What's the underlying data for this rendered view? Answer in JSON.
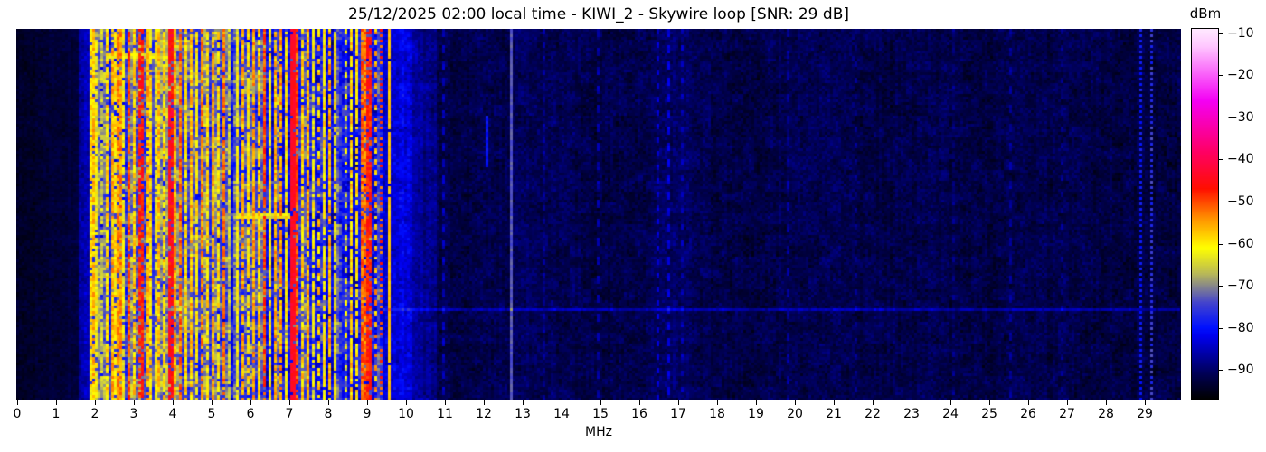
{
  "chart_data": {
    "type": "heatmap",
    "title": "25/12/2025 02:00 local time - KIWI_2 - Skywire loop [SNR: 29 dB]",
    "xlabel": "MHz",
    "x_range": [
      0,
      29.92
    ],
    "x_ticks": [
      0,
      1,
      2,
      3,
      4,
      5,
      6,
      7,
      8,
      9,
      10,
      11,
      12,
      13,
      14,
      15,
      16,
      17,
      18,
      19,
      20,
      21,
      22,
      23,
      24,
      25,
      26,
      27,
      28,
      29
    ],
    "colorbar": {
      "label": "dBm",
      "value_range": [
        -97,
        -9
      ],
      "ticks": [
        {
          "v": -10,
          "label": "−10"
        },
        {
          "v": -20,
          "label": "−20"
        },
        {
          "v": -30,
          "label": "−30"
        },
        {
          "v": -40,
          "label": "−40"
        },
        {
          "v": -50,
          "label": "−50"
        },
        {
          "v": -60,
          "label": "−60"
        },
        {
          "v": -70,
          "label": "−70"
        },
        {
          "v": -80,
          "label": "−80"
        },
        {
          "v": -90,
          "label": "−90"
        }
      ]
    },
    "colormap_stops": [
      [
        -97,
        "#000000"
      ],
      [
        -91,
        "#000055"
      ],
      [
        -82,
        "#0000ee"
      ],
      [
        -80,
        "#0011ff"
      ],
      [
        -74,
        "#4444cc"
      ],
      [
        -67,
        "#bbbb55"
      ],
      [
        -61,
        "#ffff00"
      ],
      [
        -54,
        "#ff9100"
      ],
      [
        -47,
        "#ff0f00"
      ],
      [
        -38,
        "#ff0066"
      ],
      [
        -26,
        "#f400f4"
      ],
      [
        -13,
        "#ffc8ff"
      ],
      [
        -9,
        "#ffe9ff"
      ]
    ],
    "bands": [
      {
        "f0": 0.0,
        "f1": 1.55,
        "base": -94.5,
        "v": 1.6,
        "cv": 0.5,
        "lf": 0.6
      },
      {
        "f0": 1.55,
        "f1": 1.83,
        "base": -88.0,
        "v": 3.0,
        "cv": 1.5,
        "lf": 1.0
      },
      {
        "f0": 1.83,
        "f1": 9.4,
        "base": -78.0,
        "v": 5.5,
        "cv": 4.5,
        "lf": 4.5
      },
      {
        "f0": 9.4,
        "f1": 10.15,
        "base": -85.5,
        "v": 3.5,
        "cv": 1.2,
        "lf": 1.5
      },
      {
        "f0": 10.15,
        "f1": 10.8,
        "base": -89.5,
        "v": 2.8,
        "cv": 0.8,
        "lf": 1.2
      },
      {
        "f0": 10.8,
        "f1": 29.92,
        "base": -92.3,
        "v": 2.6,
        "cv": 0.7,
        "lf": 1.2
      }
    ],
    "humps": [
      {
        "c": 3.9,
        "s": 1.6,
        "a": 6.0
      },
      {
        "c": 10.0,
        "s": 0.5,
        "a": 3.0
      },
      {
        "c": 13.3,
        "s": 0.9,
        "a": 1.5
      },
      {
        "c": 16.9,
        "s": 0.6,
        "a": 2.2
      },
      {
        "c": 20.6,
        "s": 0.9,
        "a": 1.0
      },
      {
        "c": 23.4,
        "s": 0.8,
        "a": 0.8
      },
      {
        "c": 26.6,
        "s": 0.8,
        "a": 0.8
      }
    ],
    "carriers": [
      {
        "f": 1.87,
        "level": -60
      },
      {
        "f": 1.96,
        "level": -57
      },
      {
        "f": 2.06,
        "level": -62
      },
      {
        "f": 2.18,
        "level": -66
      },
      {
        "f": 2.3,
        "level": -59
      },
      {
        "f": 2.42,
        "level": -56
      },
      {
        "f": 2.55,
        "level": -60
      },
      {
        "f": 2.63,
        "level": -54,
        "w": 0.1
      },
      {
        "f": 2.76,
        "level": -62
      },
      {
        "f": 2.89,
        "level": -51,
        "w": 0.1
      },
      {
        "f": 3.01,
        "level": -58
      },
      {
        "f": 3.13,
        "level": -60
      },
      {
        "f": 3.21,
        "level": -47,
        "w": 0.12
      },
      {
        "f": 3.34,
        "level": -56
      },
      {
        "f": 3.44,
        "level": -59
      },
      {
        "f": 3.56,
        "level": -62
      },
      {
        "f": 3.66,
        "level": -57
      },
      {
        "f": 3.79,
        "level": -59
      },
      {
        "f": 3.89,
        "level": -62
      },
      {
        "f": 3.96,
        "level": -45,
        "w": 0.12
      },
      {
        "f": 4.09,
        "level": -56
      },
      {
        "f": 4.21,
        "level": -52
      },
      {
        "f": 4.34,
        "level": -59
      },
      {
        "f": 4.48,
        "level": -57
      },
      {
        "f": 4.63,
        "level": -60
      },
      {
        "f": 4.76,
        "level": -54,
        "w": 0.1
      },
      {
        "f": 4.91,
        "level": -59
      },
      {
        "f": 5.02,
        "level": -56
      },
      {
        "f": 5.16,
        "level": -60
      },
      {
        "f": 5.31,
        "level": -53
      },
      {
        "f": 5.46,
        "level": -66
      },
      {
        "f": 5.63,
        "level": -62
      },
      {
        "f": 5.81,
        "level": -56,
        "w": 0.1
      },
      {
        "f": 5.96,
        "level": -60
      },
      {
        "f": 6.08,
        "level": -55
      },
      {
        "f": 6.21,
        "level": -58
      },
      {
        "f": 6.36,
        "level": -50,
        "w": 0.1
      },
      {
        "f": 6.51,
        "level": -60
      },
      {
        "f": 6.63,
        "level": -56
      },
      {
        "f": 6.81,
        "level": -55
      },
      {
        "f": 6.93,
        "level": -60
      },
      {
        "f": 7.06,
        "level": -44,
        "w": 0.14,
        "jit": 4,
        "drop": 0.05
      },
      {
        "f": 7.19,
        "level": -50
      },
      {
        "f": 7.33,
        "level": -58
      },
      {
        "f": 7.46,
        "level": -56
      },
      {
        "f": 7.61,
        "level": -62
      },
      {
        "f": 7.76,
        "level": -58,
        "dash": [
          3,
          5
        ]
      },
      {
        "f": 7.91,
        "level": -60
      },
      {
        "f": 8.06,
        "level": -56
      },
      {
        "f": 8.18,
        "level": -61
      },
      {
        "f": 8.46,
        "level": -63,
        "dash": [
          2,
          4
        ]
      },
      {
        "f": 8.61,
        "level": -58
      },
      {
        "f": 8.76,
        "level": -60
      },
      {
        "f": 8.91,
        "level": -52,
        "w": 0.1
      },
      {
        "f": 9.06,
        "level": -47,
        "w": 0.12
      },
      {
        "f": 9.22,
        "level": -56,
        "dash": [
          2,
          4
        ]
      },
      {
        "f": 9.33,
        "level": -50,
        "dash": [
          1,
          2
        ]
      },
      {
        "f": 9.56,
        "level": -57,
        "jit": 3,
        "drop": 0.02
      },
      {
        "f": 10.95,
        "level": -85,
        "dash": [
          3,
          6
        ]
      },
      {
        "f": 12.05,
        "level": -80,
        "y0": 0.23,
        "y1": 0.37
      },
      {
        "f": 12.72,
        "level": -73
      },
      {
        "f": 13.55,
        "level": -87,
        "dash": [
          2,
          5
        ]
      },
      {
        "f": 14.95,
        "level": -86,
        "dash": [
          3,
          7
        ]
      },
      {
        "f": 16.45,
        "level": -84,
        "dash": [
          2,
          5
        ]
      },
      {
        "f": 16.78,
        "level": -83,
        "dash": [
          3,
          6
        ]
      },
      {
        "f": 17.12,
        "level": -85,
        "dash": [
          2,
          6
        ]
      },
      {
        "f": 19.85,
        "level": -87,
        "dash": [
          3,
          8
        ]
      },
      {
        "f": 21.55,
        "level": -88,
        "dash": [
          2,
          6
        ]
      },
      {
        "f": 24.05,
        "level": -88,
        "dash": [
          2,
          7
        ]
      },
      {
        "f": 25.55,
        "level": -87,
        "dash": [
          3,
          7
        ]
      },
      {
        "f": 26.9,
        "level": -88,
        "dash": [
          2,
          6
        ]
      },
      {
        "f": 28.88,
        "level": -79,
        "dash": [
          1,
          2
        ]
      },
      {
        "f": 29.19,
        "level": -76,
        "dash": [
          1,
          2
        ],
        "jit": 6
      }
    ],
    "events": [
      {
        "y0": 0.063,
        "y1": 0.073,
        "f0": 2.3,
        "f1": 3.6,
        "level": -63
      },
      {
        "y0": 0.496,
        "y1": 0.506,
        "f0": 5.6,
        "f1": 7.05,
        "level": -64
      },
      {
        "y0": 0.75,
        "y1": 0.758,
        "f0": 9.4,
        "f1": 29.92,
        "boost": 6
      }
    ]
  }
}
